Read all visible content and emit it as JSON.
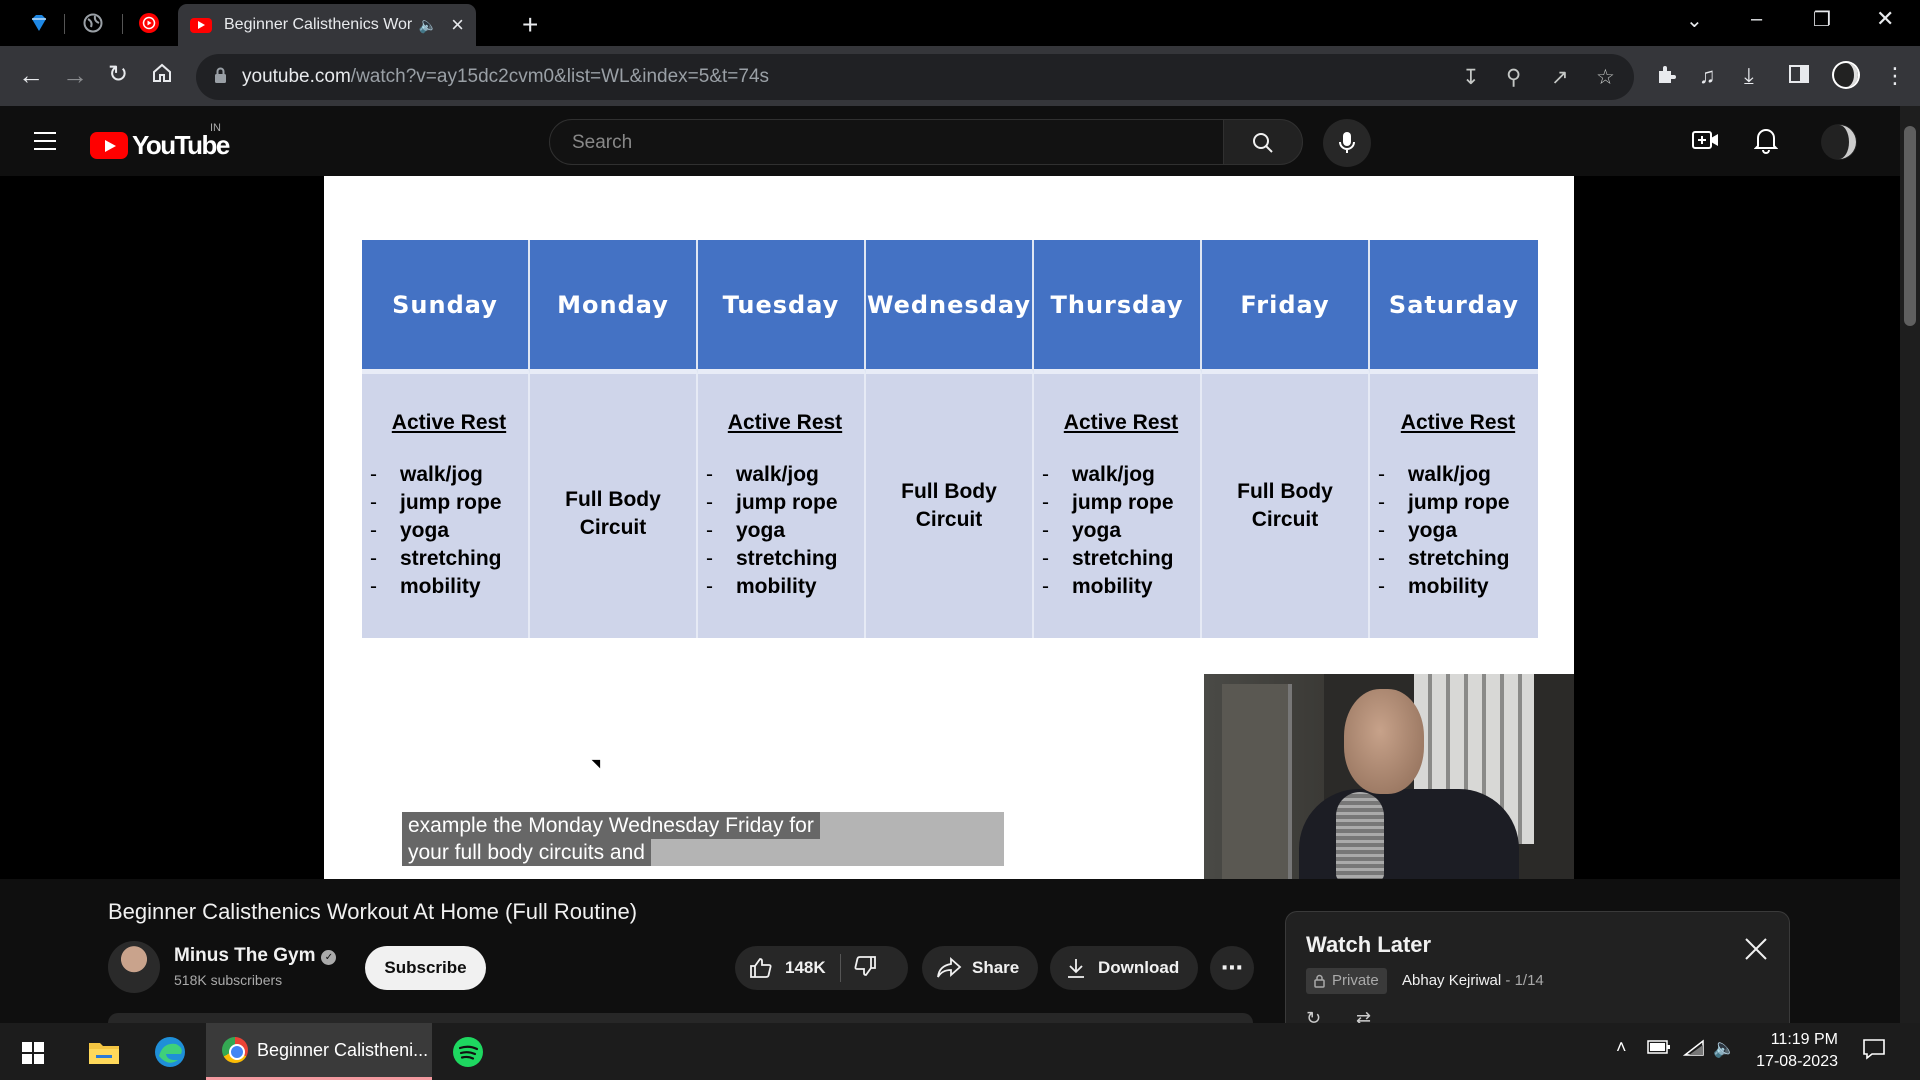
{
  "browser": {
    "active_tab_title": "Beginner Calisthenics Workout At Home (Full Routine)",
    "url_host": "youtube.com",
    "url_path": "/watch?v=ay15dc2cvm0&list=WL&index=5&t=74s"
  },
  "youtube": {
    "country_code": "IN",
    "search_placeholder": "Search",
    "logo_text": "YouTube"
  },
  "schedule": {
    "days": [
      "Sunday",
      "Monday",
      "Tuesday",
      "Wednesday",
      "Thursday",
      "Friday",
      "Saturday"
    ],
    "active_rest_title": "Active Rest",
    "active_rest_items": [
      "walk/jog",
      "jump rope",
      "yoga",
      "stretching",
      "mobility"
    ],
    "full_body_line1": "Full Body",
    "full_body_line2": "Circuit",
    "dash": "-"
  },
  "caption": {
    "line1": "example the Monday Wednesday Friday for",
    "line2": "your full body circuits and"
  },
  "video": {
    "title": "Beginner Calisthenics Workout At Home (Full Routine)",
    "channel": "Minus The Gym",
    "subscribers": "518K subscribers",
    "subscribe_label": "Subscribe",
    "likes": "148K",
    "share_label": "Share",
    "download_label": "Download"
  },
  "watch_later": {
    "title": "Watch Later",
    "privacy": "Private",
    "owner": "Abhay Kejriwal",
    "position": "1/14"
  },
  "taskbar": {
    "chrome_label": "Beginner Calistheni...",
    "time": "11:19 PM",
    "date": "17-08-2023"
  },
  "colors": {
    "header_blue": "#4472c4",
    "cell_lavender": "#cfd5ea",
    "youtube_red": "#ff0000"
  }
}
